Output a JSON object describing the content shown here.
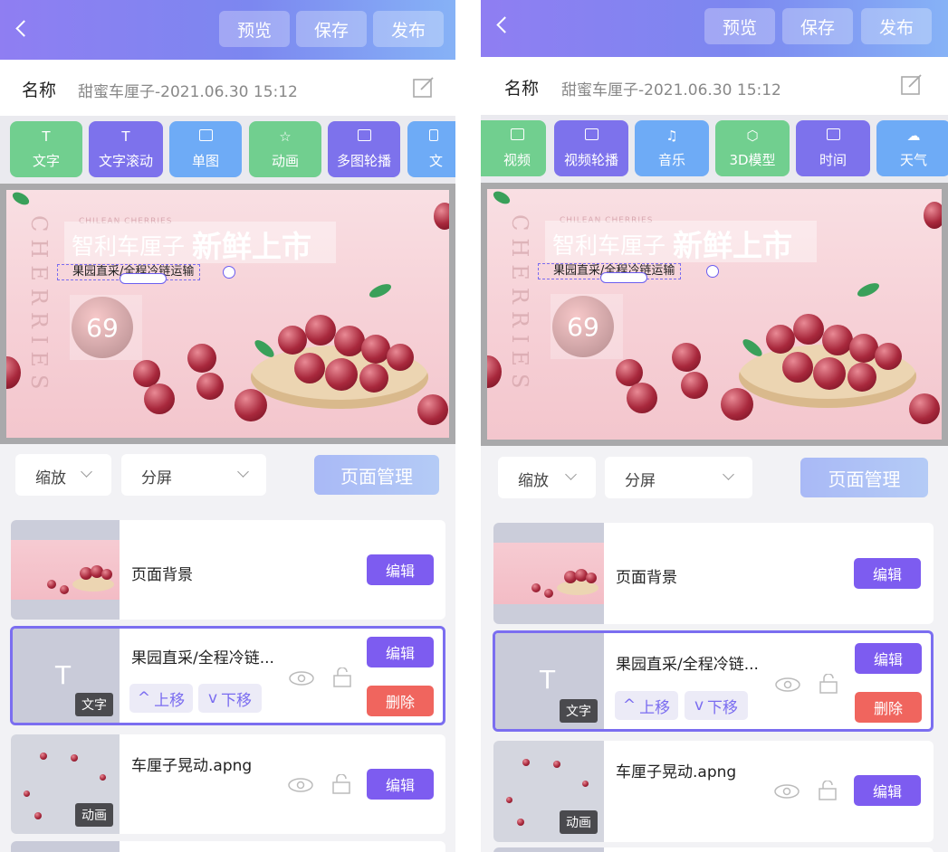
{
  "header": {
    "preview_label": "预览",
    "save_label": "保存",
    "publish_label": "发布"
  },
  "name_row": {
    "label": "名称",
    "value": "甜蜜车厘子-2021.06.30 15:12"
  },
  "tools_left": [
    {
      "label": "文字",
      "icon": "T",
      "color": "green"
    },
    {
      "label": "文字滚动",
      "icon": "T",
      "color": "purple"
    },
    {
      "label": "单图",
      "icon": "image-icon",
      "color": "blue"
    },
    {
      "label": "动画",
      "icon": "star-icon",
      "color": "green"
    },
    {
      "label": "多图轮播",
      "icon": "images-icon",
      "color": "purple"
    },
    {
      "label": "文",
      "icon": "doc-icon",
      "color": "blue"
    }
  ],
  "tools_right": [
    {
      "label": "视频",
      "icon": "video-icon",
      "color": "green"
    },
    {
      "label": "视频轮播",
      "icon": "video-carousel-icon",
      "color": "purple"
    },
    {
      "label": "音乐",
      "icon": "music-icon",
      "color": "blue"
    },
    {
      "label": "3D模型",
      "icon": "cube-icon",
      "color": "green"
    },
    {
      "label": "时间",
      "icon": "calendar-icon",
      "color": "purple"
    },
    {
      "label": "天气",
      "icon": "cloud-icon",
      "color": "blue"
    }
  ],
  "poster": {
    "small_text": "CHILEAN CHERRIES",
    "vertical_text": "CHERRIES",
    "title1": "智利车厘子",
    "title2": "新鲜上市",
    "subtitle": "果园直采/全程冷链运输",
    "badge_number": "69"
  },
  "controls": {
    "zoom_label": "缩放",
    "split_label": "分屏",
    "page_manage_label": "页面管理"
  },
  "layers": [
    {
      "name": "页面背景",
      "edit": "编辑"
    },
    {
      "name": "果园直采/全程冷链...",
      "tag": "文字",
      "up": "上移",
      "down": "下移",
      "edit": "编辑",
      "delete": "删除"
    },
    {
      "name": "车厘子晃动.apng",
      "tag": "动画",
      "edit": "编辑"
    }
  ],
  "colors": {
    "header_gradient_start": "#8f7ef2",
    "header_gradient_end": "#86b2f6",
    "edit_button": "#7d5cf0",
    "delete_button": "#f0655e",
    "selected_border": "#7b6ef0"
  }
}
